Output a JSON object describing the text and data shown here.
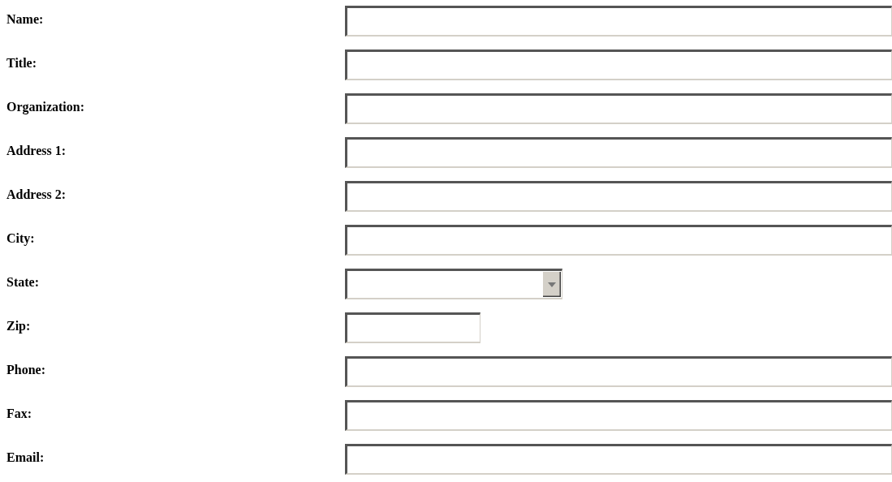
{
  "form": {
    "fields": [
      {
        "label": "Name:",
        "kind": "text"
      },
      {
        "label": "Title:",
        "kind": "text"
      },
      {
        "label": "Organization:",
        "kind": "text"
      },
      {
        "label": "Address 1:",
        "kind": "text"
      },
      {
        "label": "Address 2:",
        "kind": "text"
      },
      {
        "label": "City:",
        "kind": "text"
      },
      {
        "label": "State:",
        "kind": "select"
      },
      {
        "label": "Zip:",
        "kind": "short"
      },
      {
        "label": "Phone:",
        "kind": "text"
      },
      {
        "label": "Fax:",
        "kind": "text"
      },
      {
        "label": "Email:",
        "kind": "text"
      }
    ]
  }
}
